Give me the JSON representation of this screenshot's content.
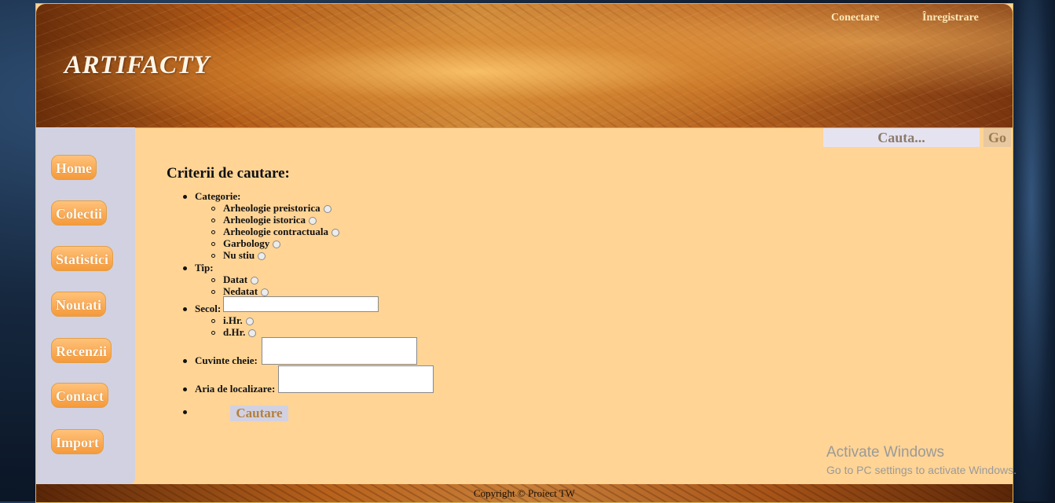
{
  "header": {
    "site_title": "ARTIFACTY",
    "links": {
      "login": "Conectare",
      "register": "Înregistrare"
    }
  },
  "search": {
    "placeholder": "Cauta...",
    "go_label": "Go"
  },
  "sidebar": {
    "items": [
      {
        "label": "Home"
      },
      {
        "label": "Colectii"
      },
      {
        "label": "Statistici"
      },
      {
        "label": "Noutati"
      },
      {
        "label": "Recenzii"
      },
      {
        "label": "Contact"
      },
      {
        "label": "Import"
      }
    ]
  },
  "criteria": {
    "title": "Criterii de cautare:",
    "categorie": {
      "label": "Categorie:",
      "options": [
        "Arheologie preistorica",
        "Arheologie istorica",
        "Arheologie contractuala",
        "Garbology",
        "Nu stiu"
      ]
    },
    "tip": {
      "label": "Tip:",
      "options": [
        "Datat",
        "Nedatat"
      ]
    },
    "secol": {
      "label": "Secol:",
      "value": "",
      "options": [
        "i.Hr.",
        "d.Hr."
      ]
    },
    "cuvinte_cheie": {
      "label": "Cuvinte cheie:",
      "value": ""
    },
    "aria": {
      "label": "Aria de localizare:",
      "value": ""
    },
    "submit_label": "Cautare"
  },
  "footer": {
    "copyright": "Copyright © Proiect TW"
  },
  "overlay": {
    "activate_title": "Activate Windows",
    "activate_sub": "Go to PC settings to activate Windows."
  },
  "colors": {
    "page_bg": "#ffd495",
    "sidebar_bg": "#d2d1e2",
    "nav_button": "#f59a3a",
    "accent_text": "#b5803c"
  }
}
